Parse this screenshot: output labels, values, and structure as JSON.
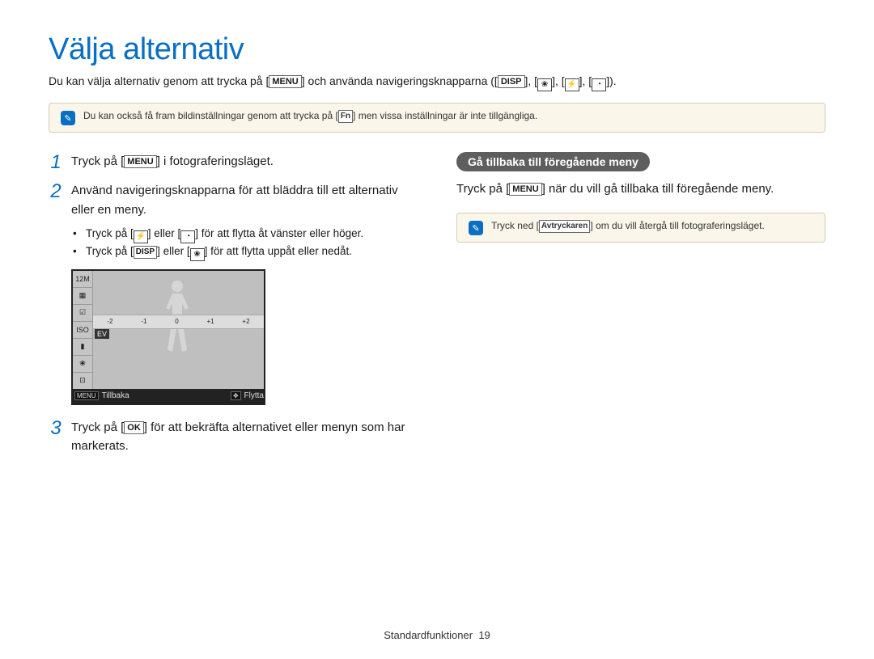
{
  "title": "Välja alternativ",
  "intro": {
    "prefix": "Du kan välja alternativ genom att trycka på [",
    "menu": "MENU",
    "mid": "] och använda navigeringsknapparna ([",
    "disp": "DISP",
    "sep": "], [",
    "close": "]).",
    "icon_flower": "❀",
    "icon_flash": "⚡",
    "icon_timer": "◔"
  },
  "top_note": {
    "before": "Du kan också få fram bildinställningar genom att trycka på [",
    "fn": "Fn",
    "after": "] men vissa inställningar är inte tillgängliga."
  },
  "steps": {
    "s1": {
      "num": "1",
      "pre": "Tryck på [",
      "key": "MENU",
      "post": "] i fotograferingsläget."
    },
    "s2": {
      "num": "2",
      "text": "Använd navigeringsknapparna för att bläddra till ett alternativ eller en meny."
    },
    "s2a": {
      "pre": "Tryck på [",
      "k1": "⚡",
      "mid": "] eller [",
      "k2": "◔",
      "post": "] för att flytta åt vänster eller höger."
    },
    "s2b": {
      "pre": "Tryck på [",
      "k1": "DISP",
      "mid": "] eller [",
      "k2": "❀",
      "post": "] för att flytta uppåt eller nedåt."
    },
    "s3": {
      "num": "3",
      "pre": "Tryck på [",
      "key": "OK",
      "post": "] för att bekräfta alternativet eller menyn som har markerats."
    }
  },
  "lcd": {
    "side_icons": [
      "12M",
      "▦",
      "☑",
      "ISO",
      "▮",
      "❀",
      "⊡"
    ],
    "ev_ticks": [
      "-2",
      "-1",
      "0",
      "+1",
      "+2"
    ],
    "ev_label": "EV",
    "foot_back_key": "MENU",
    "foot_back": "Tillbaka",
    "foot_move_key": "✥",
    "foot_move": "Flytta"
  },
  "right": {
    "pill": "Gå tillbaka till föregående meny",
    "text_pre": "Tryck på [",
    "text_key": "MENU",
    "text_post": "] när du vill gå tillbaka till föregående meny.",
    "note_pre": "Tryck ned [",
    "note_key": "Avtryckaren",
    "note_post": "] om du vill återgå till fotograferingsläget."
  },
  "footer": {
    "section": "Standardfunktioner",
    "page": "19"
  }
}
